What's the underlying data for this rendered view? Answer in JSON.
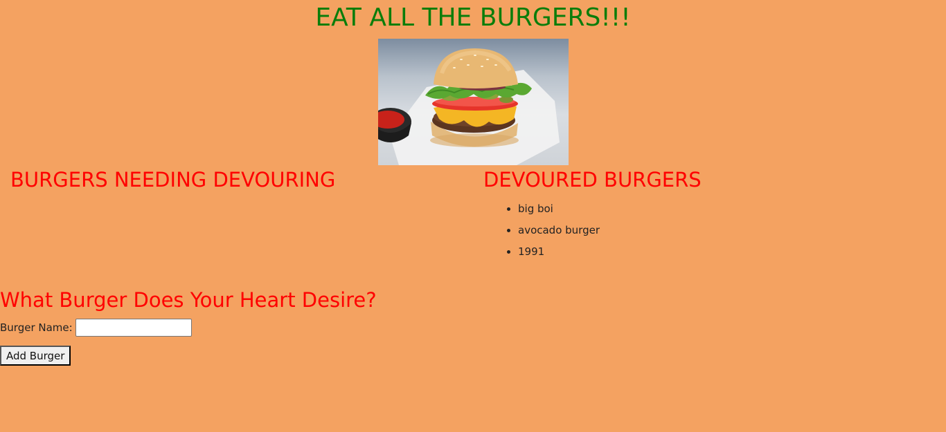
{
  "header": {
    "title": "EAT ALL THE BURGERS!!!"
  },
  "sections": {
    "needing_heading": "BURGERS NEEDING DEVOURING",
    "needing_items": [],
    "devoured_heading": "DEVOURED BURGERS",
    "devoured_items": [
      "big boi",
      "avocado burger",
      "1991"
    ]
  },
  "form": {
    "heading": "What Burger Does Your Heart Desire?",
    "name_label": "Burger Name:",
    "name_value": "",
    "name_placeholder": "",
    "submit_label": "Add Burger"
  },
  "colors": {
    "background": "#f4a261",
    "title": "#0a7d0a",
    "headings": "#ff0000"
  },
  "icons": {
    "hero": "burger-photo"
  }
}
